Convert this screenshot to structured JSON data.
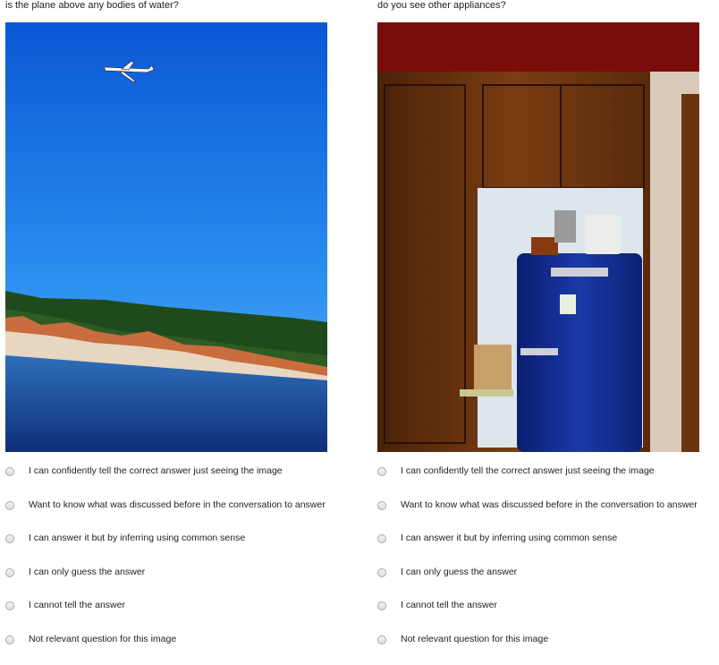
{
  "items": [
    {
      "question": "is the plane above any bodies of water?",
      "image_icon": "airplane-over-coastal-town-photo"
    },
    {
      "question": "do you see other appliances?",
      "image_icon": "blue-vintage-refrigerator-photo"
    }
  ],
  "options": [
    "I can confidently tell the correct answer just seeing the image",
    "Want to know what was discussed before in the conversation to answer",
    "I can answer it but by inferring using common sense",
    "I can only guess the answer",
    "I cannot tell the answer",
    "Not relevant question for this image"
  ]
}
